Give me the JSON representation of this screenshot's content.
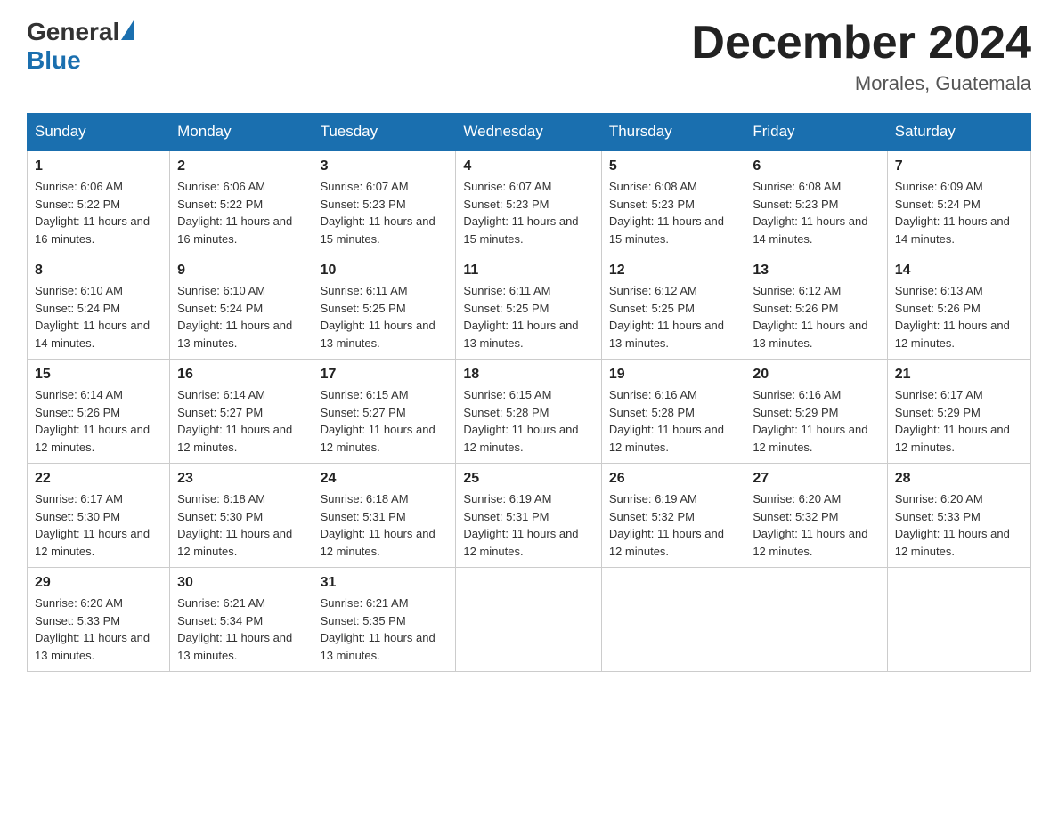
{
  "logo": {
    "general": "General",
    "blue": "Blue"
  },
  "title": "December 2024",
  "location": "Morales, Guatemala",
  "days_of_week": [
    "Sunday",
    "Monday",
    "Tuesday",
    "Wednesday",
    "Thursday",
    "Friday",
    "Saturday"
  ],
  "weeks": [
    [
      {
        "day": "1",
        "sunrise": "6:06 AM",
        "sunset": "5:22 PM",
        "daylight": "11 hours and 16 minutes."
      },
      {
        "day": "2",
        "sunrise": "6:06 AM",
        "sunset": "5:22 PM",
        "daylight": "11 hours and 16 minutes."
      },
      {
        "day": "3",
        "sunrise": "6:07 AM",
        "sunset": "5:23 PM",
        "daylight": "11 hours and 15 minutes."
      },
      {
        "day": "4",
        "sunrise": "6:07 AM",
        "sunset": "5:23 PM",
        "daylight": "11 hours and 15 minutes."
      },
      {
        "day": "5",
        "sunrise": "6:08 AM",
        "sunset": "5:23 PM",
        "daylight": "11 hours and 15 minutes."
      },
      {
        "day": "6",
        "sunrise": "6:08 AM",
        "sunset": "5:23 PM",
        "daylight": "11 hours and 14 minutes."
      },
      {
        "day": "7",
        "sunrise": "6:09 AM",
        "sunset": "5:24 PM",
        "daylight": "11 hours and 14 minutes."
      }
    ],
    [
      {
        "day": "8",
        "sunrise": "6:10 AM",
        "sunset": "5:24 PM",
        "daylight": "11 hours and 14 minutes."
      },
      {
        "day": "9",
        "sunrise": "6:10 AM",
        "sunset": "5:24 PM",
        "daylight": "11 hours and 13 minutes."
      },
      {
        "day": "10",
        "sunrise": "6:11 AM",
        "sunset": "5:25 PM",
        "daylight": "11 hours and 13 minutes."
      },
      {
        "day": "11",
        "sunrise": "6:11 AM",
        "sunset": "5:25 PM",
        "daylight": "11 hours and 13 minutes."
      },
      {
        "day": "12",
        "sunrise": "6:12 AM",
        "sunset": "5:25 PM",
        "daylight": "11 hours and 13 minutes."
      },
      {
        "day": "13",
        "sunrise": "6:12 AM",
        "sunset": "5:26 PM",
        "daylight": "11 hours and 13 minutes."
      },
      {
        "day": "14",
        "sunrise": "6:13 AM",
        "sunset": "5:26 PM",
        "daylight": "11 hours and 12 minutes."
      }
    ],
    [
      {
        "day": "15",
        "sunrise": "6:14 AM",
        "sunset": "5:26 PM",
        "daylight": "11 hours and 12 minutes."
      },
      {
        "day": "16",
        "sunrise": "6:14 AM",
        "sunset": "5:27 PM",
        "daylight": "11 hours and 12 minutes."
      },
      {
        "day": "17",
        "sunrise": "6:15 AM",
        "sunset": "5:27 PM",
        "daylight": "11 hours and 12 minutes."
      },
      {
        "day": "18",
        "sunrise": "6:15 AM",
        "sunset": "5:28 PM",
        "daylight": "11 hours and 12 minutes."
      },
      {
        "day": "19",
        "sunrise": "6:16 AM",
        "sunset": "5:28 PM",
        "daylight": "11 hours and 12 minutes."
      },
      {
        "day": "20",
        "sunrise": "6:16 AM",
        "sunset": "5:29 PM",
        "daylight": "11 hours and 12 minutes."
      },
      {
        "day": "21",
        "sunrise": "6:17 AM",
        "sunset": "5:29 PM",
        "daylight": "11 hours and 12 minutes."
      }
    ],
    [
      {
        "day": "22",
        "sunrise": "6:17 AM",
        "sunset": "5:30 PM",
        "daylight": "11 hours and 12 minutes."
      },
      {
        "day": "23",
        "sunrise": "6:18 AM",
        "sunset": "5:30 PM",
        "daylight": "11 hours and 12 minutes."
      },
      {
        "day": "24",
        "sunrise": "6:18 AM",
        "sunset": "5:31 PM",
        "daylight": "11 hours and 12 minutes."
      },
      {
        "day": "25",
        "sunrise": "6:19 AM",
        "sunset": "5:31 PM",
        "daylight": "11 hours and 12 minutes."
      },
      {
        "day": "26",
        "sunrise": "6:19 AM",
        "sunset": "5:32 PM",
        "daylight": "11 hours and 12 minutes."
      },
      {
        "day": "27",
        "sunrise": "6:20 AM",
        "sunset": "5:32 PM",
        "daylight": "11 hours and 12 minutes."
      },
      {
        "day": "28",
        "sunrise": "6:20 AM",
        "sunset": "5:33 PM",
        "daylight": "11 hours and 12 minutes."
      }
    ],
    [
      {
        "day": "29",
        "sunrise": "6:20 AM",
        "sunset": "5:33 PM",
        "daylight": "11 hours and 13 minutes."
      },
      {
        "day": "30",
        "sunrise": "6:21 AM",
        "sunset": "5:34 PM",
        "daylight": "11 hours and 13 minutes."
      },
      {
        "day": "31",
        "sunrise": "6:21 AM",
        "sunset": "5:35 PM",
        "daylight": "11 hours and 13 minutes."
      },
      null,
      null,
      null,
      null
    ]
  ]
}
